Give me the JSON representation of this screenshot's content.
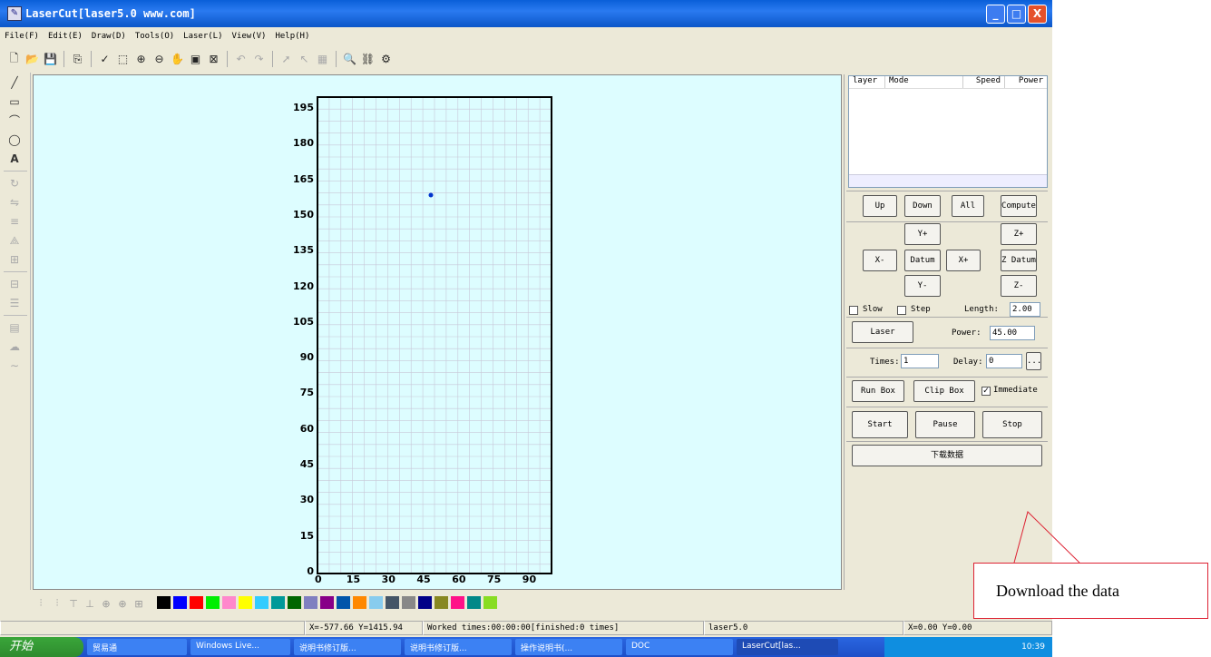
{
  "window": {
    "title": "LaserCut[laser5.0 www.com]",
    "btn_min": "_",
    "btn_max": "□",
    "btn_close": "X"
  },
  "menu": [
    "File(F)",
    "Edit(E)",
    "Draw(D)",
    "Tools(O)",
    "Laser(L)",
    "View(V)",
    "Help(H)"
  ],
  "canvas": {
    "y_ticks": [
      "195",
      "180",
      "165",
      "150",
      "135",
      "120",
      "105",
      "90",
      "75",
      "60",
      "45",
      "30",
      "15",
      "0"
    ],
    "x_ticks": [
      "0",
      "15",
      "30",
      "45",
      "60",
      "75",
      "90"
    ]
  },
  "layer_table": {
    "headers": [
      "layer",
      "Mode",
      "Speed",
      "Power"
    ]
  },
  "panel": {
    "up": "Up",
    "down": "Down",
    "all": "All",
    "compute": "Compute",
    "y_plus": "Y+",
    "z_plus": "Z+",
    "x_minus": "X-",
    "datum": "Datum",
    "x_plus": "X+",
    "z_datum": "Z Datum",
    "y_minus": "Y-",
    "z_minus": "Z-",
    "slow": "Slow",
    "step": "Step",
    "length_label": "Length:",
    "length_value": "2.00",
    "laser": "Laser",
    "power_label": "Power:",
    "power_value": "45.00",
    "times_label": "Times:",
    "times_value": "1",
    "delay_label": "Delay:",
    "delay_value": "0",
    "more": "...",
    "run_box": "Run Box",
    "clip_box": "Clip Box",
    "immediate": "Immediate",
    "start": "Start",
    "pause": "Pause",
    "stop": "Stop",
    "download": "下载数据"
  },
  "palette_colors": [
    "#000000",
    "#0000ff",
    "#ff0000",
    "#00ee00",
    "#ff88cc",
    "#ffff00",
    "#33ccff",
    "#009999",
    "#006600",
    "#8080c0",
    "#880088",
    "#0055aa",
    "#ff8800",
    "#88ccee",
    "#445566",
    "#888888",
    "#000088",
    "#888822",
    "#ff1188",
    "#008888",
    "#88dd22"
  ],
  "status": {
    "coords": "X=-577.66 Y=1415.94",
    "worked": "Worked times:00:00:00[finished:0 times]",
    "device": "laser5.0",
    "pos": "X=0.00 Y=0.00"
  },
  "taskbar": {
    "start": "开始",
    "tasks": [
      "贸易通",
      "Windows Live...",
      "说明书修订版...",
      "说明书修订版...",
      "操作说明书(...",
      "DOC",
      "LaserCut[las..."
    ],
    "clock": "10:39"
  },
  "callout": {
    "text": "Download the data"
  }
}
